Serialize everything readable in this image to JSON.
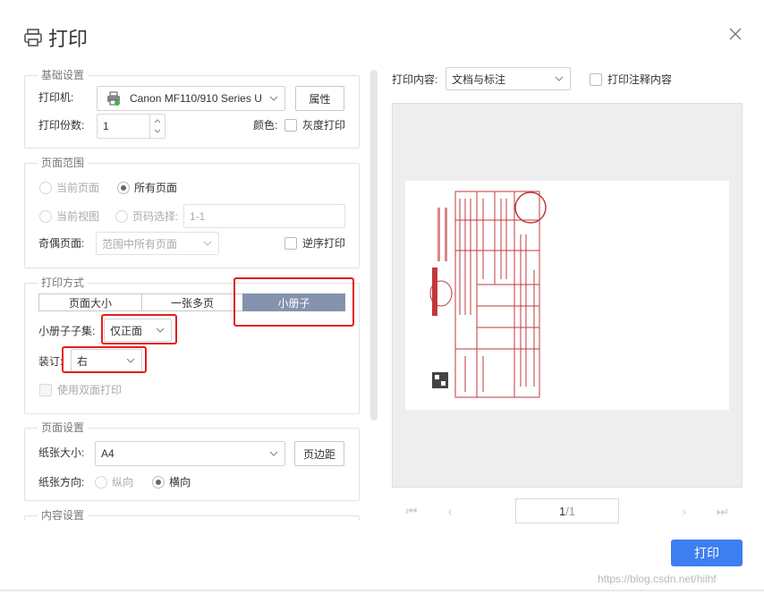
{
  "dialog": {
    "title": "打印"
  },
  "basic": {
    "legend": "基础设置",
    "printer_label": "打印机:",
    "printer_value": "Canon MF110/910 Series U",
    "properties_button": "属性",
    "copies_label": "打印份数:",
    "copies_value": "1",
    "color_label": "颜色:",
    "grayscale_label": "灰度打印"
  },
  "range": {
    "legend": "页面范围",
    "current_page": "当前页面",
    "all_pages": "所有页面",
    "current_view": "当前视图",
    "page_select": "页码选择:",
    "page_select_value": "1-1",
    "odd_even_label": "奇偶页面:",
    "odd_even_value": "范围中所有页面",
    "reverse_label": "逆序打印"
  },
  "mode": {
    "legend": "打印方式",
    "tabs": [
      "页面大小",
      "一张多页",
      "小册子"
    ],
    "booklet_subset_label": "小册子子集:",
    "booklet_subset_value": "仅正面",
    "binding_label": "装订:",
    "binding_value": "右",
    "duplex_label": "使用双面打印"
  },
  "page_setup": {
    "legend": "页面设置",
    "paper_size_label": "纸张大小:",
    "paper_size_value": "A4",
    "margins_button": "页边距",
    "orientation_label": "纸张方向:",
    "portrait": "纵向",
    "landscape": "横向"
  },
  "content_setup": {
    "legend": "内容设置"
  },
  "preview": {
    "content_label": "打印内容:",
    "content_value": "文档与标注",
    "print_annotations": "打印注释内容",
    "page_current": "1",
    "page_total": "/1"
  },
  "actions": {
    "print": "打印"
  },
  "watermark": "https://blog.csdn.net/hilhf",
  "colors": {
    "accent": "#3d7ff0",
    "highlight": "#e21d1d",
    "segment_active": "#8592ad"
  }
}
